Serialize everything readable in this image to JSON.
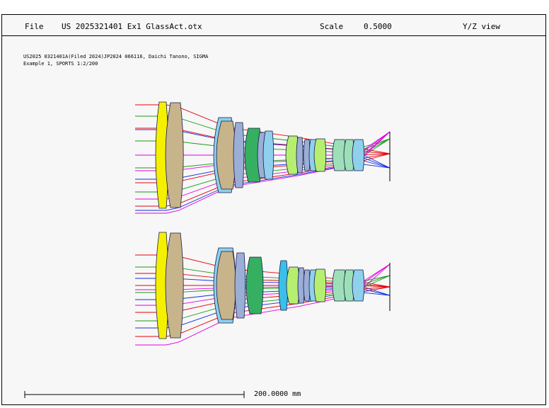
{
  "header": {
    "file_label": "File",
    "file_name": "US 2025321401 Ex1 GlassAct.otx",
    "scale_label": "Scale",
    "scale_value": "0.5000",
    "view_label": "Y/Z view"
  },
  "description": {
    "line1": "US2025 0321401A(Filed 2024)JP2024 066116, Daichi Tanono, SIGMA",
    "line2": "Example 1, SPORTS 1:2/200"
  },
  "scale_bar": {
    "label": "200.0000 mm"
  },
  "colors": {
    "ray_red": "#e8000a",
    "ray_green": "#1a9a1a",
    "ray_blue": "#1030e0",
    "ray_magenta": "#e000e0",
    "lens_yellow": "#f4f000",
    "lens_tan": "#c8b48a",
    "lens_lightblue": "#8fd0ec",
    "lens_steelblue": "#9aaed6",
    "lens_green": "#34b060",
    "lens_lightgreen": "#b6ee70",
    "lens_mint": "#9de0b8",
    "lens_cyan": "#3ac0e8"
  }
}
